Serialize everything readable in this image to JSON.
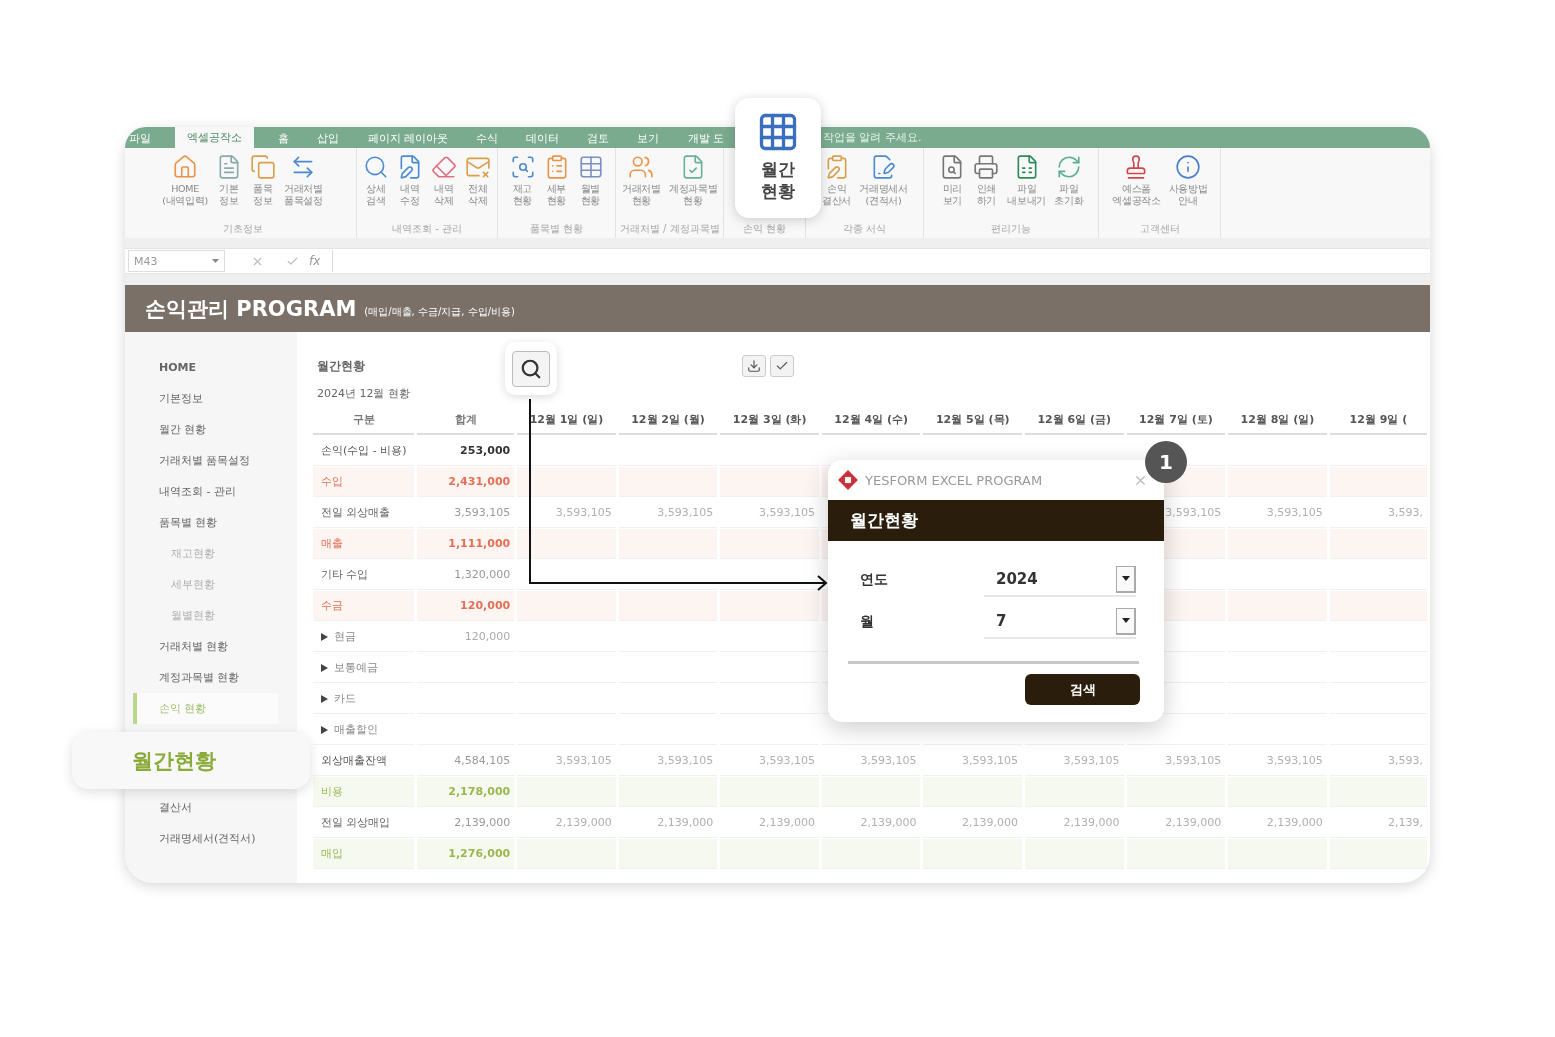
{
  "ribbon": {
    "tabs": [
      {
        "label": "파일",
        "selected": false
      },
      {
        "label": "엑셀공작소",
        "selected": true
      },
      {
        "label": "홈",
        "selected": false
      },
      {
        "label": "삽입",
        "selected": false
      },
      {
        "label": "페이지 레이아웃",
        "selected": false
      },
      {
        "label": "수식",
        "selected": false
      },
      {
        "label": "데이터",
        "selected": false
      },
      {
        "label": "검토",
        "selected": false
      },
      {
        "label": "보기",
        "selected": false
      },
      {
        "label": "개발 도",
        "selected": false
      }
    ],
    "tell_me": "작업을 알려 주세요.",
    "groups": [
      {
        "label": "기초정보",
        "buttons": [
          "HOME\n(내역입력)",
          "기본\n정보",
          "품목\n정보",
          "거래처별\n품목설정"
        ]
      },
      {
        "label": "내역조회 - 관리",
        "buttons": [
          "상세\n검색",
          "내역\n수정",
          "내역\n삭제",
          "전체\n삭제"
        ]
      },
      {
        "label": "품목별 현황",
        "buttons": [
          "재고\n현황",
          "세부\n현황",
          "월별\n현황"
        ]
      },
      {
        "label": "거래처별 / 계정과목별",
        "buttons": [
          "거래처별\n현황",
          "계정과목별\n현황"
        ]
      },
      {
        "label": "손익 현황",
        "callout": "월간\n현황"
      },
      {
        "label": "각종 서식",
        "buttons": [
          "손익\n결산서",
          "거래명세서\n(견적서)"
        ]
      },
      {
        "label": "편리기능",
        "buttons": [
          "미리\n보기",
          "인쇄\n하기",
          "파일\n내보내기",
          "파일\n초기화"
        ]
      },
      {
        "label": "고객센터",
        "buttons": [
          "예스폼\n엑셀공작소",
          "사용방법\n안내"
        ]
      }
    ]
  },
  "formula_bar": {
    "name_box": "M43",
    "function_symbol": "fx"
  },
  "header": {
    "title": "손익관리 PROGRAM",
    "subtitle": "(매입/매출, 수금/지급, 수입/비용)"
  },
  "sidebar": {
    "items": [
      {
        "kind": "link",
        "label": "HOME",
        "selected": false
      },
      {
        "kind": "link",
        "label": "기본정보",
        "selected": false
      },
      {
        "kind": "link",
        "label": "월간 현황",
        "selected": false
      },
      {
        "kind": "link",
        "label": "거래처별 품목설정",
        "selected": false
      },
      {
        "kind": "link",
        "label": "내역조회 - 관리",
        "selected": false
      },
      {
        "kind": "link",
        "label": "품목별 현황",
        "selected": false,
        "children": [
          {
            "kind": "link",
            "label": "재고현황",
            "selected": false
          },
          {
            "kind": "link",
            "label": "세부현황",
            "selected": false
          },
          {
            "kind": "link",
            "label": "월별현황",
            "selected": false
          }
        ]
      },
      {
        "kind": "link",
        "label": "거래처별 현황",
        "selected": false
      },
      {
        "kind": "link",
        "label": "계정과목별 현황",
        "selected": false
      },
      {
        "kind": "link",
        "label": "손익 현황",
        "selected": true
      },
      {
        "kind": "callout",
        "label": "월간현황",
        "selected": false
      },
      {
        "kind": "link",
        "label": "결산서",
        "selected": false
      },
      {
        "kind": "link",
        "label": "거래명세서(견적서)",
        "selected": false
      }
    ]
  },
  "table": {
    "title": "월간현황",
    "subtitle": "2024년 12월 현황",
    "columns": [
      "구분",
      "합계",
      "12월 1일 (일)",
      "12월 2일 (월)",
      "12월 3일 (화)",
      "12월 4일 (수)",
      "12월 5일 (목)",
      "12월 6일 (금)",
      "12월 7일 (토)",
      "12월 8일 (일)",
      "12월 9일 ("
    ],
    "rows": [
      {
        "kind": "total",
        "label": "손익(수입 - 비용)",
        "total": "253,000"
      },
      {
        "kind": "income",
        "label": "수입",
        "total": "2,431,000"
      },
      {
        "kind": "plain",
        "label": "전일 외상매출",
        "total": "3,593,105",
        "days": {
          "1": "3,593,105",
          "2": "3,593,105",
          "3": "3,593,105",
          "7": "3,593,105",
          "8": "3,593,105",
          "9": "3,593,"
        }
      },
      {
        "kind": "income",
        "label": "매출",
        "total": "1,111,000"
      },
      {
        "kind": "plain",
        "label": "기타 수입",
        "total": "1,320,000"
      },
      {
        "kind": "income",
        "label": "수금",
        "total": "120,000"
      },
      {
        "kind": "sub",
        "label": "현금",
        "total": "120,000"
      },
      {
        "kind": "sub",
        "label": "보통예금"
      },
      {
        "kind": "sub",
        "label": "카드"
      },
      {
        "kind": "sub",
        "label": "매출할인"
      },
      {
        "kind": "balance",
        "label": "외상매출잔액",
        "total": "4,584,105",
        "days": [
          "3,593,105",
          "3,593,105",
          "3,593,105",
          "3,593,105",
          "3,593,105",
          "3,593,105",
          "3,593,105",
          "3,593,105",
          "3,593,"
        ]
      },
      {
        "kind": "expense",
        "label": "비용",
        "total": "2,178,000"
      },
      {
        "kind": "plain",
        "label": "전일 외상매입",
        "total": "2,139,000",
        "days": [
          "2,139,000",
          "2,139,000",
          "2,139,000",
          "2,139,000",
          "2,139,000",
          "2,139,000",
          "2,139,000",
          "2,139,000",
          "2,139,"
        ]
      },
      {
        "kind": "expense",
        "label": "매입",
        "total": "1,276,000"
      }
    ]
  },
  "dialog": {
    "title": "YESFORM EXCEL PROGRAM",
    "heading": "월간현황",
    "fields": [
      {
        "label": "연도",
        "value": "2024"
      },
      {
        "label": "월",
        "value": "7"
      }
    ],
    "button": "검색",
    "badge": "1"
  }
}
